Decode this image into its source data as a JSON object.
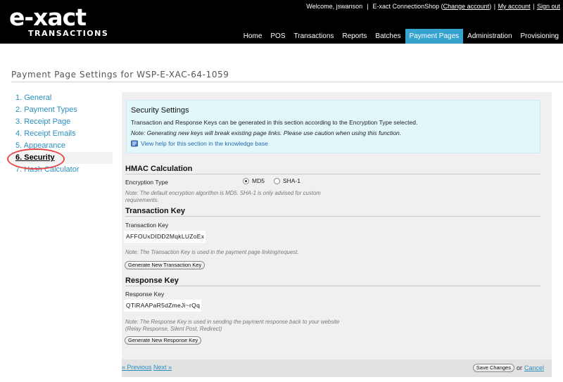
{
  "header": {
    "logo_main": "e-xact",
    "logo_sub": "TRANSACTIONS",
    "welcome": "Welcome, jswanson",
    "shop": "E-xact ConnectionShop",
    "change_account": "Change account",
    "my_account": "My account",
    "sign_out": "Sign out",
    "nav": [
      "Home",
      "POS",
      "Transactions",
      "Reports",
      "Batches",
      "Payment Pages",
      "Administration",
      "Provisioning"
    ],
    "active_nav": "Payment Pages"
  },
  "page": {
    "title": "Payment Page Settings for WSP-E-XAC-64-1059"
  },
  "sidebar": {
    "items": [
      {
        "label": "1. General"
      },
      {
        "label": "2. Payment Types"
      },
      {
        "label": "3. Receipt Page"
      },
      {
        "label": "4. Receipt Emails"
      },
      {
        "label": "5. Appearance"
      },
      {
        "label": "6. Security"
      },
      {
        "label": "7. Hash Calculator"
      }
    ],
    "current": "6. Security"
  },
  "info": {
    "title": "Security Settings",
    "text": "Transaction and Response Keys can be generated in this section according to the Encryption Type selected.",
    "note": "Note: Generating new keys will break existing page links. Please use caution when using this function.",
    "help_link": "View help for this section in the knowledge base"
  },
  "hmac": {
    "heading": "HMAC Calculation",
    "encryption_label": "Encryption Type",
    "options": [
      "MD5",
      "SHA-1"
    ],
    "selected": "MD5",
    "note_line1": "Note: The default encryption algorithm is MD5. SHA-1 is only advised for custom",
    "note_line2": "requirements."
  },
  "transaction_key": {
    "heading": "Transaction Key",
    "label": "Transaction Key",
    "value": "AFFOUxDIDD2MqkLUZoEx",
    "note": "Note: The Transaction Key is used in the payment page linking/request.",
    "button": "Generate New Transaction Key"
  },
  "response_key": {
    "heading": "Response Key",
    "label": "Response Key",
    "value": "QTiRAAPaR5dZmeJi~rQq",
    "note_line1": "Note: The Response Key is used in sending the payment response back to your website",
    "note_line2": "(Relay Response, Silent Post, Redirect)",
    "button": "Generate New Response Key"
  },
  "footer": {
    "previous": "« Previous",
    "next": "Next »",
    "save": "Save Changes",
    "or": "or",
    "cancel": "Cancel"
  },
  "colors": {
    "header_bg": "#000000",
    "active_tab": "#36a3cf",
    "link": "#2a8fbf",
    "info_bg": "#e2f7fa",
    "highlight": "#e84848"
  }
}
